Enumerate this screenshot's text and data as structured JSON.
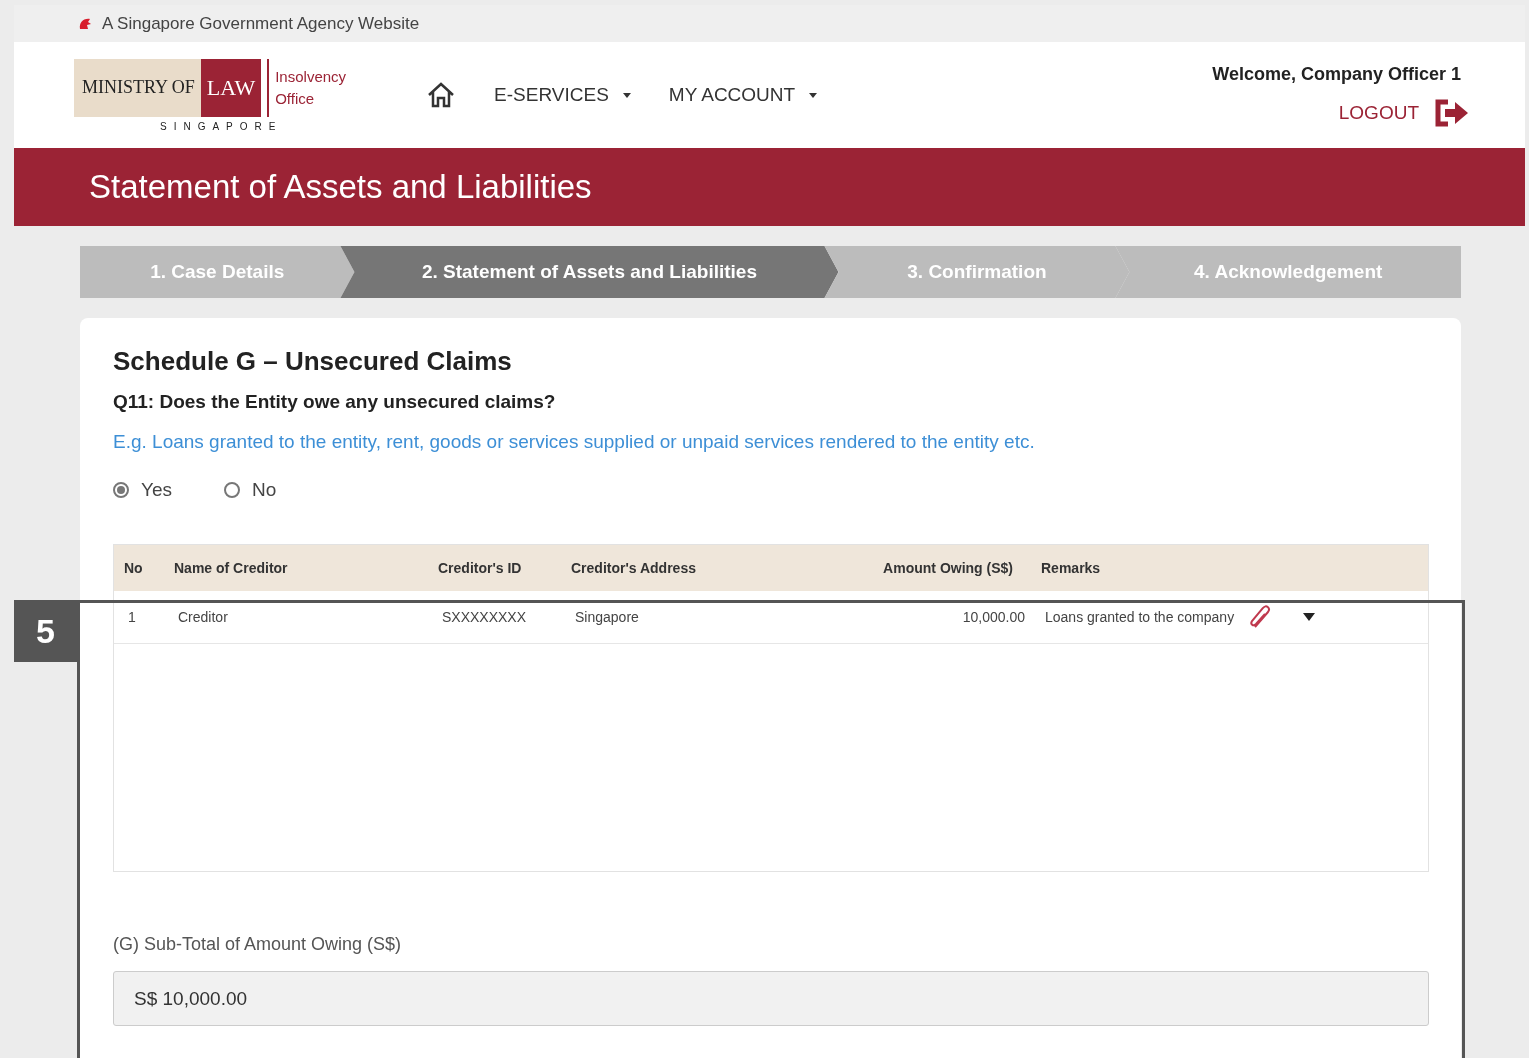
{
  "top_bar": {
    "text": "A Singapore Government Agency Website"
  },
  "header": {
    "logo": {
      "ministry": "MINISTRY OF",
      "law": "LAW",
      "country": "SINGAPORE",
      "office_line1": "Insolvency",
      "office_line2": "Office"
    },
    "nav": [
      {
        "label": "E-SERVICES"
      },
      {
        "label": "MY ACCOUNT"
      }
    ],
    "welcome": "Welcome, Company Officer 1",
    "logout": "LOGOUT"
  },
  "banner": {
    "title": "Statement of Assets and Liabilities"
  },
  "steps": [
    {
      "label": "1. Case Details",
      "selected": false
    },
    {
      "label": "2. Statement of Assets and Liabilities",
      "selected": true
    },
    {
      "label": "3. Confirmation",
      "selected": false
    },
    {
      "label": "4. Acknowledgement",
      "selected": false
    }
  ],
  "form": {
    "heading": "Schedule G – Unsecured Claims",
    "question": "Q11: Does the Entity owe any unsecured claims?",
    "hint": "E.g. Loans granted to the entity, rent, goods or services supplied or unpaid services rendered to the entity etc.",
    "options": [
      {
        "label": "Yes",
        "selected": true
      },
      {
        "label": "No",
        "selected": false
      }
    ],
    "table": {
      "columns": [
        "No",
        "Name of Creditor",
        "Creditor's ID",
        "Creditor's Address",
        "Amount Owing (S$)",
        "Remarks"
      ],
      "rows": [
        {
          "no": "1",
          "name": "Creditor",
          "id": "SXXXXXXXX",
          "address": "Singapore",
          "amount": "10,000.00",
          "remarks": "Loans granted to the company"
        }
      ]
    },
    "subtotal": {
      "label": "(G) Sub-Total of Amount Owing (S$)",
      "value": "S$ 10,000.00"
    }
  },
  "callout": {
    "number": "5"
  }
}
